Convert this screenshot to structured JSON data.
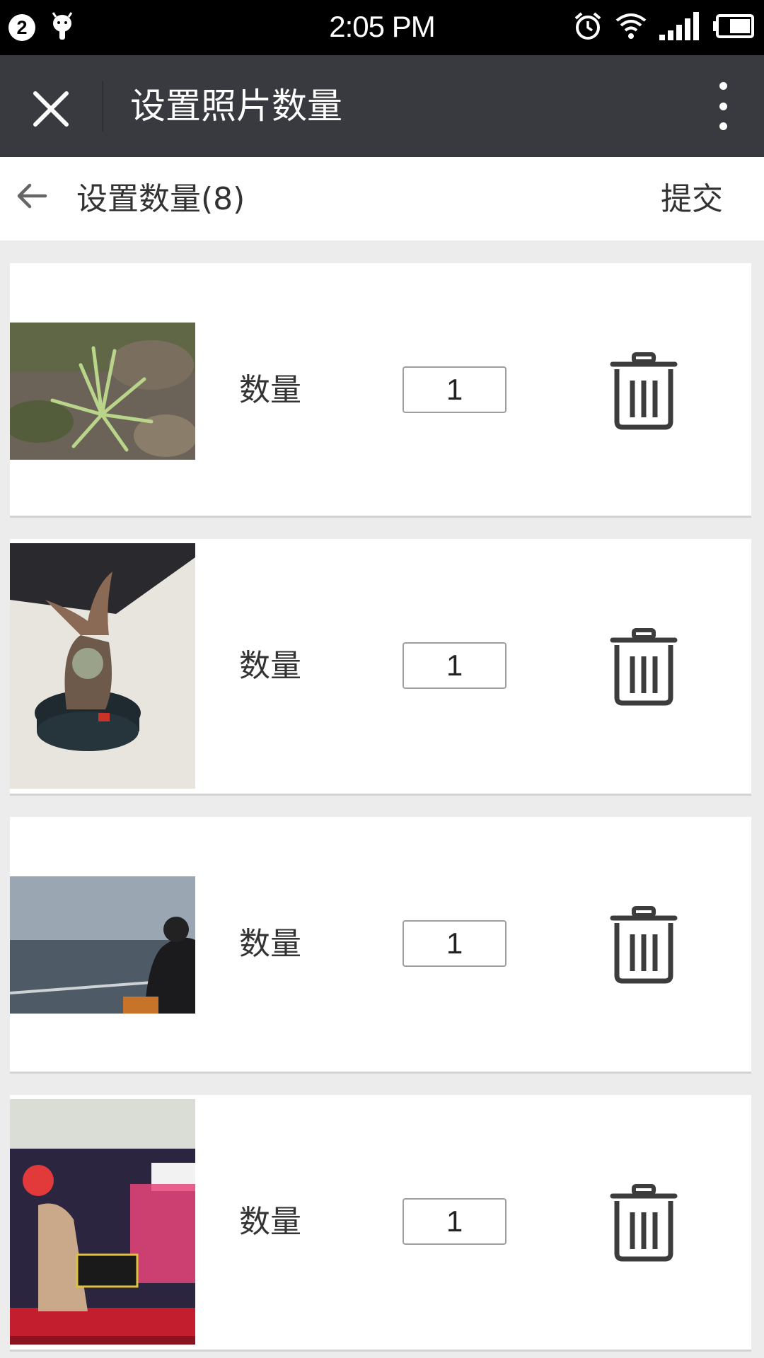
{
  "status_bar": {
    "notification_count": "2",
    "time": "2:05 PM",
    "icons": [
      "android-icon",
      "alarm-icon",
      "wifi-icon",
      "signal-icon",
      "battery-icon"
    ]
  },
  "title_bar": {
    "title": "设置照片数量",
    "close_icon": "close-icon",
    "more_icon": "more-vertical-icon"
  },
  "sub_header": {
    "back_icon": "back-arrow-icon",
    "title": "设置数量(8)",
    "submit_label": "提交"
  },
  "items": [
    {
      "label": "数量",
      "quantity": "1",
      "photo": "plant on dry leaves"
    },
    {
      "label": "数量",
      "quantity": "1",
      "photo": "figurine on desk"
    },
    {
      "label": "数量",
      "quantity": "1",
      "photo": "person photographing sea"
    },
    {
      "label": "数量",
      "quantity": "1",
      "photo": "store poster"
    }
  ],
  "colors": {
    "status_bar": "#000000",
    "title_bar": "#393a3f",
    "background": "#ececec",
    "card": "#ffffff",
    "icon": "#3c3c3c"
  }
}
